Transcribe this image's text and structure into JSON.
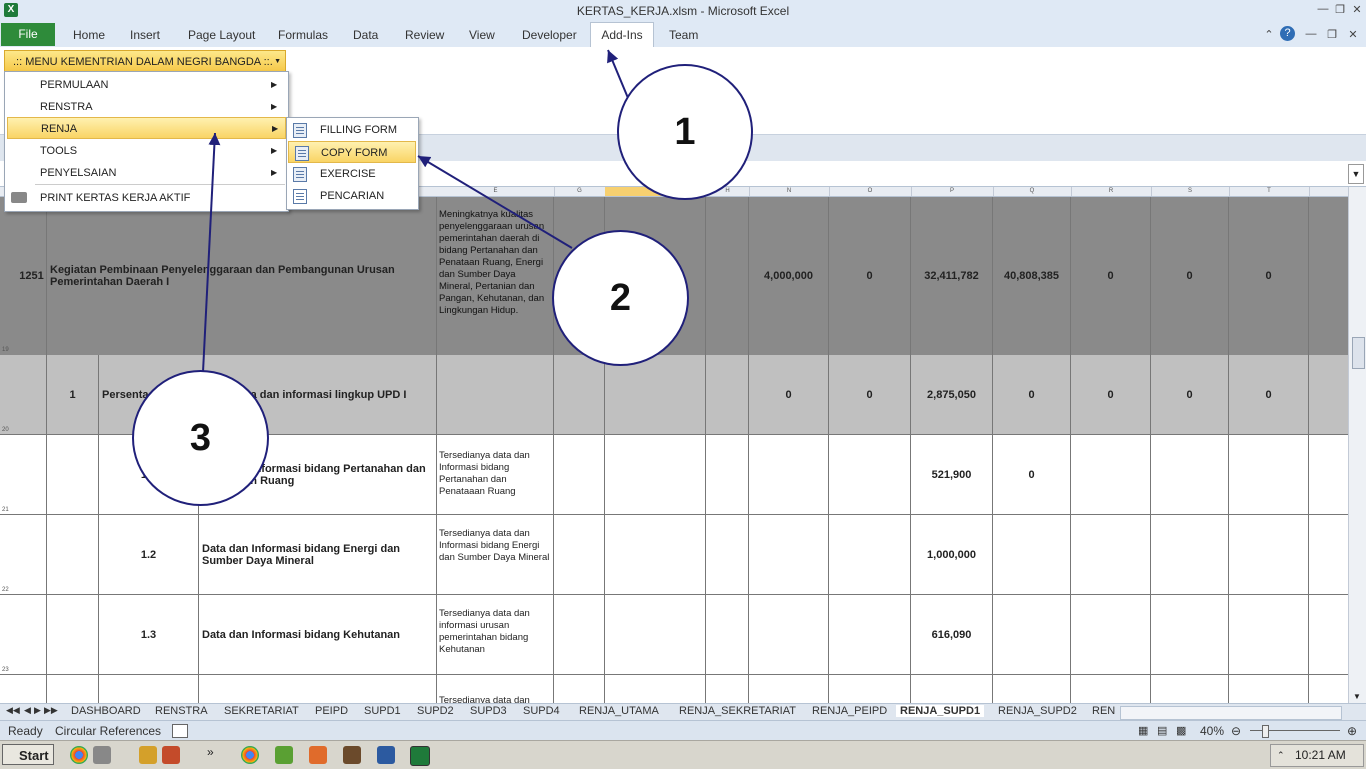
{
  "window": {
    "title": "KERTAS_KERJA.xlsm  -  Microsoft Excel",
    "app_icon": "X"
  },
  "ribbon": {
    "file_tab": "File",
    "tabs": [
      "Home",
      "Insert",
      "Page Layout",
      "Formulas",
      "Data",
      "Review",
      "View",
      "Developer",
      "Add-Ins",
      "Team"
    ],
    "menu_button": ".:: MENU KEMENTRIAN DALAM NEGRI BANGDA ::."
  },
  "menu": {
    "items": [
      {
        "label": "PERMULAAN",
        "submenu": true
      },
      {
        "label": "RENSTRA",
        "submenu": true
      },
      {
        "label": "RENJA",
        "submenu": true
      },
      {
        "label": "TOOLS",
        "submenu": true
      },
      {
        "label": "PENYELSAIAN",
        "submenu": true
      },
      {
        "label": "PRINT KERTAS KERJA AKTIF",
        "submenu": false
      }
    ],
    "submenu_items": [
      "FILLING FORM",
      "COPY FORM",
      "EXERCISE",
      "PENCARIAN"
    ]
  },
  "columns": [
    "E",
    "G",
    "",
    "H",
    "N",
    "O",
    "P",
    "Q",
    "R",
    "S",
    "T"
  ],
  "rows": [
    {
      "rownum": "19",
      "a": "1251",
      "b": "",
      "c": "Kegiatan Pembinaan Penyelenggaraan dan Pembangunan Urusan Pemerintahan Daerah I",
      "d": "Meningkatnya kualitas penyelenggaraan urusan pemerintahan daerah di bidang Pertanahan dan Penataan Ruang, Energi dan Sumber Daya Mineral, Pertanian dan Pangan, Kehutanan, dan Lingkungan Hidup.",
      "n": "4,000,000",
      "o": "0",
      "p": "32,411,782",
      "q": "40,808,385",
      "r": "0",
      "s": "0",
      "t": "0"
    },
    {
      "rownum": "20",
      "a": "",
      "b": "1",
      "c": "Persentase ketersediaan data dan informasi lingkup UPD I",
      "d": "",
      "n": "0",
      "o": "0",
      "p": "2,875,050",
      "q": "0",
      "r": "0",
      "s": "0",
      "t": "0"
    },
    {
      "rownum": "21",
      "a": "",
      "b": "1.1",
      "c": "Data dan Informasi bidang Pertanahan dan Penataaan Ruang",
      "d": "Tersedianya data dan Informasi bidang Pertanahan dan Penataaan Ruang",
      "n": "",
      "o": "",
      "p": "521,900",
      "q": "0",
      "r": "",
      "s": "",
      "t": ""
    },
    {
      "rownum": "22",
      "a": "",
      "b": "1.2",
      "c": "Data dan Informasi bidang Energi dan Sumber Daya Mineral",
      "d": "Tersedianya data dan Informasi bidang Energi dan Sumber Daya Mineral",
      "n": "",
      "o": "",
      "p": "1,000,000",
      "q": "",
      "r": "",
      "s": "",
      "t": ""
    },
    {
      "rownum": "23",
      "a": "",
      "b": "1.3",
      "c": "Data dan Informasi bidang Kehutanan",
      "d": "Tersedianya data dan informasi urusan pemerintahan bidang Kehutanan",
      "n": "",
      "o": "",
      "p": "616,090",
      "q": "",
      "r": "",
      "s": "",
      "t": ""
    },
    {
      "rownum": "",
      "a": "",
      "b": "",
      "c": "",
      "d": "Tersedianya data dan",
      "n": "",
      "o": "",
      "p": "",
      "q": "",
      "r": "",
      "s": "",
      "t": ""
    }
  ],
  "sheet_tabs": [
    "DASHBOARD",
    "RENSTRA",
    "SEKRETARIAT",
    "PEIPD",
    "SUPD1",
    "SUPD2",
    "SUPD3",
    "SUPD4",
    "RENJA_UTAMA",
    "RENJA_SEKRETARIAT",
    "RENJA_PEIPD",
    "RENJA_SUPD1",
    "RENJA_SUPD2",
    "REN"
  ],
  "active_sheet": "RENJA_SUPD1",
  "status": {
    "ready": "Ready",
    "circular": "Circular References",
    "zoom": "40%"
  },
  "taskbar": {
    "start": "Start",
    "clock": "10:21 AM"
  },
  "callouts": [
    "1",
    "2",
    "3"
  ],
  "colors": {
    "ribbon_bg": "#dfe9f5",
    "file_tab": "#2e8b3a",
    "menu_highlight": "#f9d465",
    "row_dark": "#8a8a8a",
    "row_mid": "#c0c0c0",
    "callout_border": "#20207a"
  }
}
